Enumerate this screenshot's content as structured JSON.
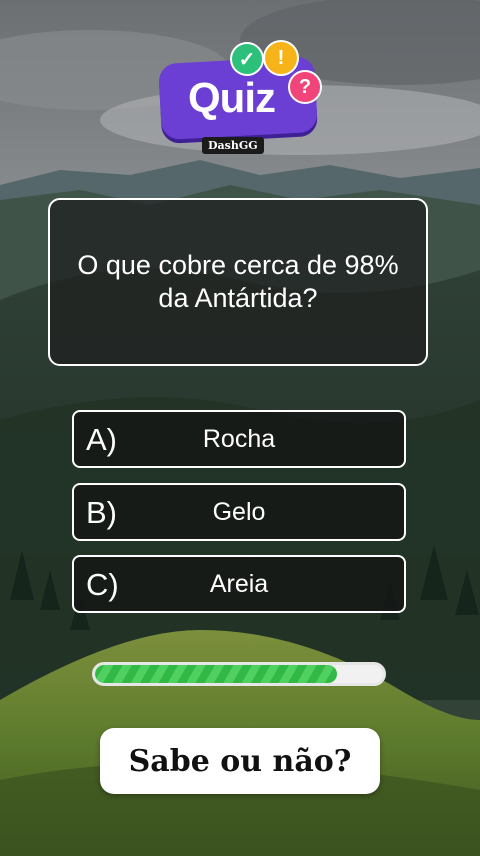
{
  "logo": {
    "word": "Quiz",
    "brand": "DashGG",
    "badges": {
      "check": "✓",
      "exclamation": "!",
      "question": "?"
    }
  },
  "question": {
    "text": "O que cobre cerca de 98% da Antártida?"
  },
  "options": [
    {
      "letter": "A)",
      "text": "Rocha"
    },
    {
      "letter": "B)",
      "text": "Gelo"
    },
    {
      "letter": "C)",
      "text": "Areia"
    }
  ],
  "progress": {
    "fraction": 0.84
  },
  "cta": {
    "text": "Sabe ou não?"
  },
  "colors": {
    "logo_purple": "#6b3fd4",
    "check_green": "#2cc07a",
    "exclaim_yellow": "#f6b41a",
    "question_pink": "#f0447a",
    "progress_green": "#32b845"
  }
}
